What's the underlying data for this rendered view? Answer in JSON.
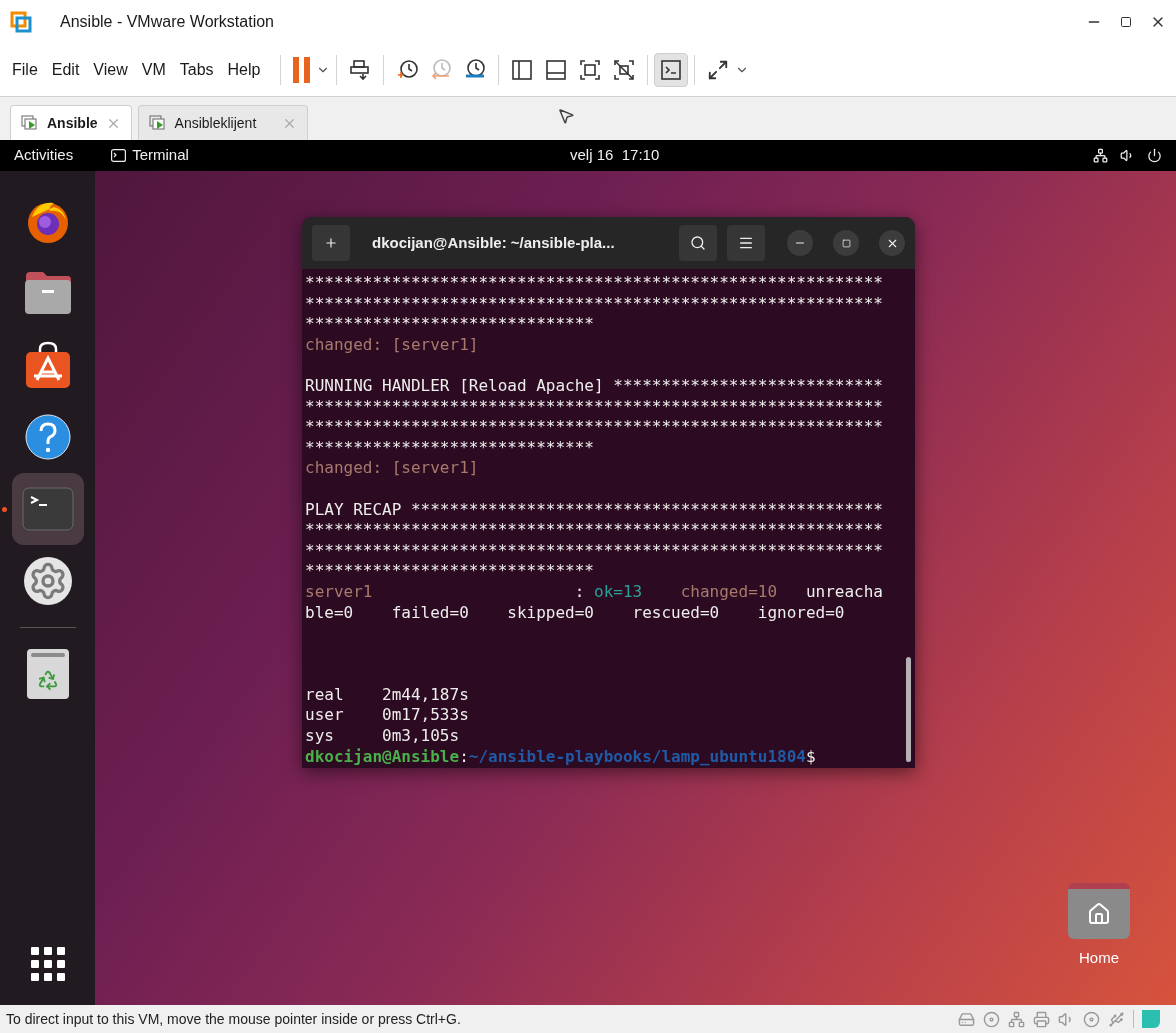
{
  "window": {
    "title": "Ansible - VMware Workstation"
  },
  "menu": [
    "File",
    "Edit",
    "View",
    "VM",
    "Tabs",
    "Help"
  ],
  "toolbar": {
    "console_view_selected": true
  },
  "tabs": [
    {
      "label": "Ansible",
      "selected": true
    },
    {
      "label": "Ansibleklijent",
      "selected": false
    }
  ],
  "topbar": {
    "activities": "Activities",
    "app": "Terminal",
    "clock": "velj 16  17:10"
  },
  "dock": [
    {
      "kind": "browser",
      "selected": false,
      "running": false
    },
    {
      "kind": "files",
      "selected": false,
      "running": false
    },
    {
      "kind": "store",
      "selected": false,
      "running": false
    },
    {
      "kind": "help",
      "selected": false,
      "running": false
    },
    {
      "kind": "terminal",
      "selected": true,
      "running": true
    },
    {
      "kind": "settings",
      "selected": false,
      "running": false
    },
    {
      "kind": "trash",
      "selected": false,
      "running": false
    }
  ],
  "terminal": {
    "title": "dkocijan@Ansible: ~/ansible-pla...",
    "lines": [
      {
        "kind": "text",
        "segments": [
          {
            "kind": "normal",
            "text": "************************************************************"
          }
        ]
      },
      {
        "kind": "text",
        "segments": [
          {
            "kind": "normal",
            "text": "************************************************************"
          }
        ]
      },
      {
        "kind": "text",
        "segments": [
          {
            "kind": "normal",
            "text": "******************************"
          }
        ]
      },
      {
        "kind": "text",
        "segments": [
          {
            "kind": "changed",
            "text": "changed: [server1]"
          }
        ]
      },
      {
        "kind": "blank"
      },
      {
        "kind": "text",
        "segments": [
          {
            "kind": "normal",
            "text": "RUNNING HANDLER [Reload Apache] ****************************"
          }
        ]
      },
      {
        "kind": "text",
        "segments": [
          {
            "kind": "normal",
            "text": "************************************************************"
          }
        ]
      },
      {
        "kind": "text",
        "segments": [
          {
            "kind": "normal",
            "text": "************************************************************"
          }
        ]
      },
      {
        "kind": "text",
        "segments": [
          {
            "kind": "normal",
            "text": "******************************"
          }
        ]
      },
      {
        "kind": "text",
        "segments": [
          {
            "kind": "changed",
            "text": "changed: [server1]"
          }
        ]
      },
      {
        "kind": "blank"
      },
      {
        "kind": "text",
        "segments": [
          {
            "kind": "normal",
            "text": "PLAY RECAP *************************************************"
          }
        ]
      },
      {
        "kind": "text",
        "segments": [
          {
            "kind": "normal",
            "text": "************************************************************"
          }
        ]
      },
      {
        "kind": "text",
        "segments": [
          {
            "kind": "normal",
            "text": "************************************************************"
          }
        ]
      },
      {
        "kind": "text",
        "segments": [
          {
            "kind": "normal",
            "text": "******************************"
          }
        ]
      },
      {
        "kind": "text",
        "segments": [
          {
            "kind": "changed",
            "text": "server1"
          },
          {
            "kind": "normal",
            "text": "                     : "
          },
          {
            "kind": "ok",
            "text": "ok=13"
          },
          {
            "kind": "changed",
            "text": "    changed=10"
          },
          {
            "kind": "normal",
            "text": "   unreacha"
          }
        ]
      },
      {
        "kind": "text",
        "segments": [
          {
            "kind": "normal",
            "text": "ble=0    failed=0    skipped=0    rescued=0    ignored=0"
          }
        ]
      },
      {
        "kind": "blank"
      },
      {
        "kind": "blank"
      },
      {
        "kind": "blank"
      },
      {
        "kind": "text",
        "segments": [
          {
            "kind": "normal",
            "text": "real    2m44,187s"
          }
        ]
      },
      {
        "kind": "text",
        "segments": [
          {
            "kind": "normal",
            "text": "user    0m17,533s"
          }
        ]
      },
      {
        "kind": "text",
        "segments": [
          {
            "kind": "normal",
            "text": "sys     0m3,105s"
          }
        ]
      },
      {
        "kind": "text",
        "segments": [
          {
            "kind": "user",
            "text": "dkocijan@Ansible"
          },
          {
            "kind": "normal",
            "text": ":"
          },
          {
            "kind": "path",
            "text": "~/ansible-playbooks/lamp_ubuntu1804"
          },
          {
            "kind": "normal",
            "text": "$"
          }
        ]
      }
    ]
  },
  "desktop_icon": {
    "label": "Home"
  },
  "status_bar": {
    "text": "To direct input to this VM, move the mouse pointer inside or press Ctrl+G."
  }
}
